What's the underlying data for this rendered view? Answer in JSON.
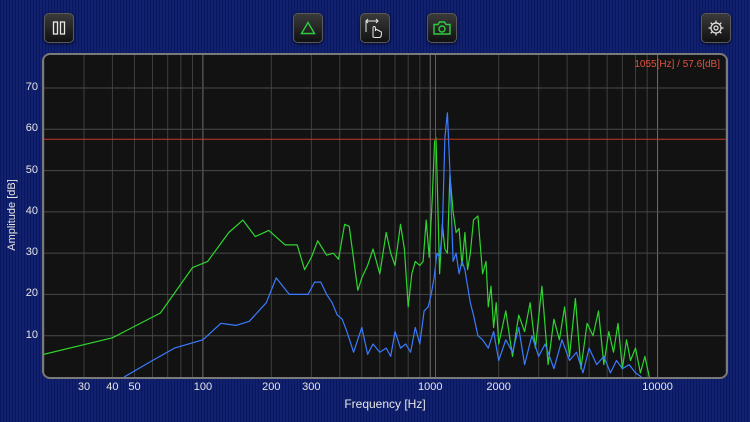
{
  "toolbar": {
    "buttons": [
      {
        "name": "pause-button",
        "icon": "pause-icon"
      },
      {
        "name": "peak-button",
        "icon": "triangle-icon"
      },
      {
        "name": "touch-measure-button",
        "icon": "hand-pointer-icon"
      },
      {
        "name": "snapshot-button",
        "icon": "camera-icon"
      },
      {
        "name": "settings-button",
        "icon": "gear-icon"
      }
    ],
    "accent_color": "#2ecc40"
  },
  "readout": "1055[Hz] / 57.6[dB]",
  "chart_data": {
    "type": "line",
    "xlabel": "Frequency [Hz]",
    "ylabel": "Amplitude [dB]",
    "x_scale": "log",
    "xlim": [
      20,
      20000
    ],
    "ylim": [
      0,
      78
    ],
    "x_ticks": [
      30,
      40,
      50,
      100,
      200,
      300,
      1000,
      2000,
      10000
    ],
    "x_tick_labels": [
      "30",
      "40",
      "50",
      "100",
      "200",
      "300",
      "1000",
      "2000",
      "10000"
    ],
    "y_ticks": [
      10,
      20,
      30,
      40,
      50,
      60,
      70
    ],
    "y_tick_labels": [
      "10",
      "20",
      "30",
      "40",
      "50",
      "60",
      "70"
    ],
    "grid": true,
    "cursor": {
      "x": 1055,
      "y": 57.6,
      "color": "#c0392b"
    },
    "series": [
      {
        "color": "#2ed52e",
        "x": [
          20,
          40,
          65,
          90,
          105,
          130,
          150,
          170,
          195,
          230,
          260,
          280,
          300,
          320,
          350,
          375,
          395,
          420,
          440,
          480,
          500,
          530,
          560,
          600,
          640,
          670,
          700,
          740,
          770,
          800,
          830,
          860,
          900,
          930,
          960,
          990,
          1020,
          1045,
          1060,
          1080,
          1100,
          1130,
          1160,
          1190,
          1220,
          1260,
          1300,
          1340,
          1380,
          1420,
          1460,
          1500,
          1550,
          1620,
          1700,
          1760,
          1800,
          1850,
          1900,
          1950,
          2000,
          2150,
          2300,
          2450,
          2600,
          2750,
          2900,
          3100,
          3300,
          3500,
          3700,
          3900,
          4100,
          4350,
          4600,
          4900,
          5200,
          5500,
          5800,
          6100,
          6400,
          6700,
          7000,
          7300,
          7600,
          8000,
          8400,
          8800,
          9200
        ],
        "y": [
          5.5,
          9.5,
          15.5,
          26.5,
          28,
          35,
          38,
          34,
          35.5,
          32,
          32,
          26,
          29,
          33,
          29.5,
          30,
          28.5,
          37,
          36.5,
          21,
          24,
          27,
          31,
          25,
          35,
          30,
          27,
          37,
          31,
          17,
          25,
          28,
          27,
          28,
          38,
          29,
          43,
          57,
          58,
          42,
          25,
          37,
          31,
          30,
          49,
          40,
          35,
          36,
          27,
          35,
          26,
          30,
          38,
          39,
          25,
          28,
          17,
          22,
          12,
          18,
          8,
          16,
          5,
          15,
          11,
          18,
          7,
          22,
          3,
          14,
          9,
          17,
          5,
          19,
          2,
          13,
          10,
          16,
          3,
          11,
          6,
          13,
          2,
          9,
          4,
          7,
          1,
          5,
          0
        ]
      },
      {
        "color": "#3a7bff",
        "x": [
          45,
          60,
          75,
          100,
          120,
          140,
          160,
          190,
          210,
          240,
          270,
          290,
          310,
          330,
          350,
          370,
          390,
          410,
          430,
          460,
          500,
          530,
          560,
          600,
          640,
          670,
          700,
          740,
          780,
          820,
          860,
          900,
          940,
          980,
          1010,
          1040,
          1070,
          1100,
          1130,
          1160,
          1190,
          1220,
          1260,
          1300,
          1340,
          1380,
          1420,
          1460,
          1500,
          1550,
          1620,
          1700,
          1800,
          1900,
          2000,
          2150,
          2300,
          2450,
          2600,
          2800,
          3000,
          3200,
          3500,
          3800,
          4100,
          4400,
          4700,
          5000,
          5400,
          5800,
          6200,
          6600,
          7000,
          7500,
          8000,
          8500
        ],
        "y": [
          0,
          4,
          7,
          9,
          13,
          12.5,
          13.5,
          18,
          24,
          20,
          20,
          20,
          23,
          23,
          20,
          18,
          15,
          14,
          11,
          6,
          12,
          5.5,
          8,
          6,
          7,
          5,
          11,
          7,
          8,
          6,
          12,
          8,
          16,
          17,
          20,
          24,
          30,
          29,
          35,
          58,
          64,
          50,
          28,
          30,
          25,
          28,
          26,
          22,
          18,
          15,
          10,
          9,
          7,
          11,
          4,
          9,
          6,
          12,
          3,
          10,
          5,
          8,
          2,
          9,
          4,
          6,
          1,
          7,
          3,
          5,
          1,
          4,
          2,
          3,
          1,
          0
        ]
      }
    ]
  }
}
